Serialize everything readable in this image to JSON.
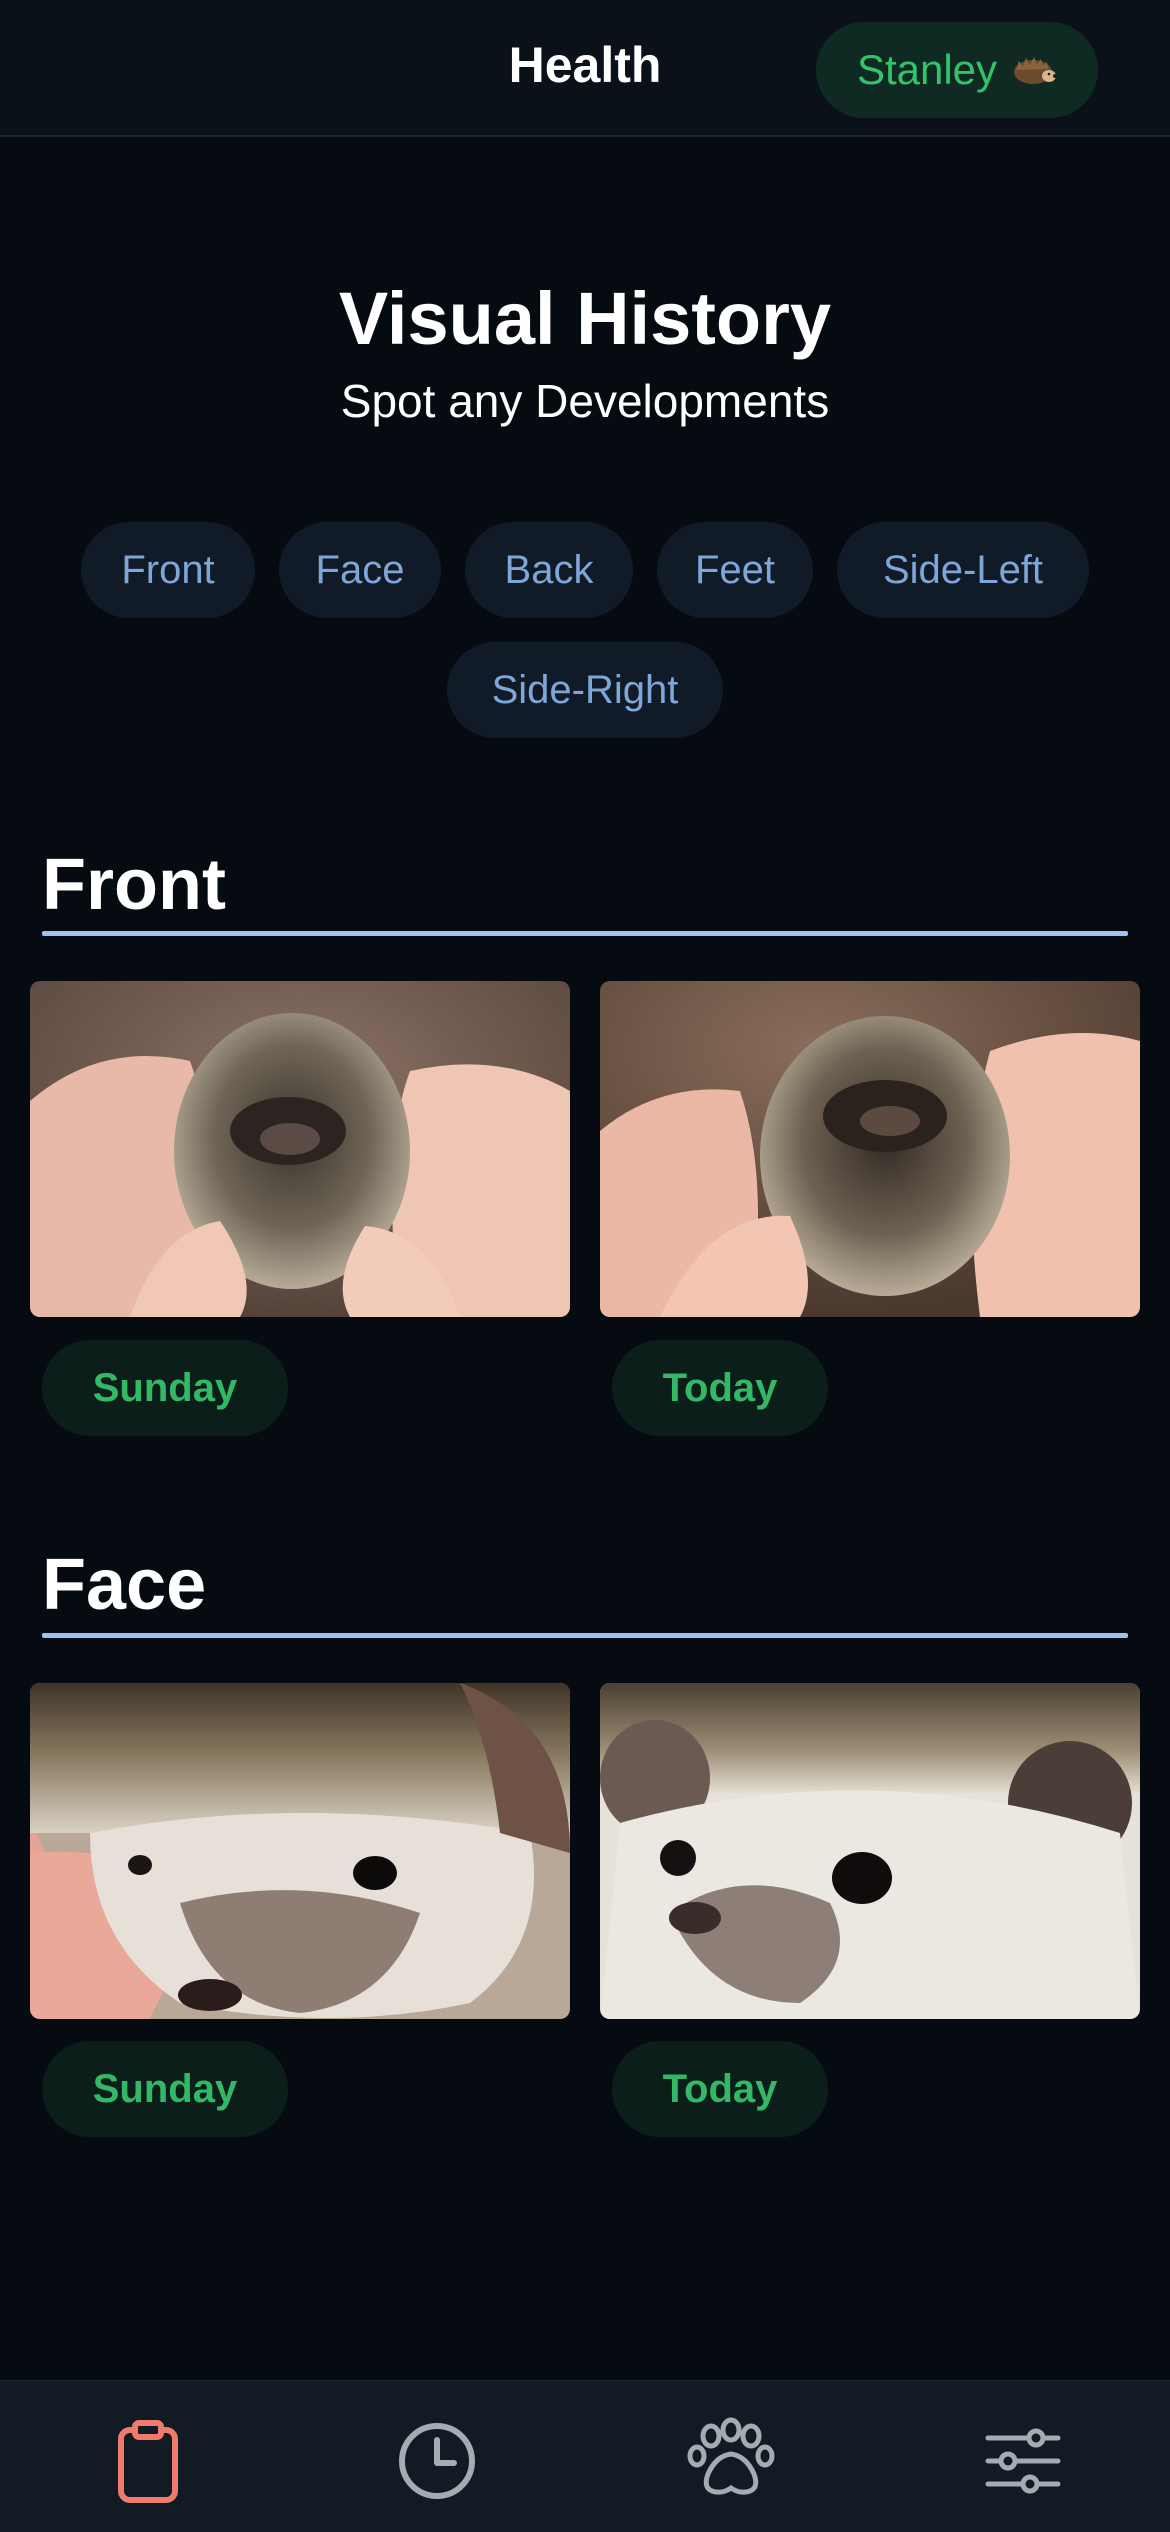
{
  "header": {
    "title": "Health",
    "pet_name": "Stanley",
    "pet_icon": "hedgehog-emoji"
  },
  "hero": {
    "title": "Visual History",
    "subtitle": "Spot any Developments"
  },
  "filters": [
    {
      "label": "Front"
    },
    {
      "label": "Face"
    },
    {
      "label": "Back"
    },
    {
      "label": "Feet"
    },
    {
      "label": "Side-Left"
    },
    {
      "label": "Side-Right"
    }
  ],
  "sections": [
    {
      "title": "Front",
      "photos": [
        {
          "day": "Sunday",
          "subject": "hedgehog-curled-in-hands"
        },
        {
          "day": "Today",
          "subject": "hedgehog-curled-in-hands"
        }
      ]
    },
    {
      "title": "Face",
      "photos": [
        {
          "day": "Sunday",
          "subject": "hedgehog-face-closeup"
        },
        {
          "day": "Today",
          "subject": "hedgehog-face-closeup"
        }
      ]
    }
  ],
  "tabbar": [
    {
      "icon": "clipboard-icon",
      "active": true
    },
    {
      "icon": "clock-icon",
      "active": false
    },
    {
      "icon": "paw-icon",
      "active": false
    },
    {
      "icon": "sliders-icon",
      "active": false
    }
  ],
  "colors": {
    "background": "#060b12",
    "accent_green": "#32b866",
    "chip_text": "#7fa6d8",
    "rule": "#9ec1ef",
    "active_tab": "#f07a6c",
    "inactive_tab": "#a6abb3"
  }
}
